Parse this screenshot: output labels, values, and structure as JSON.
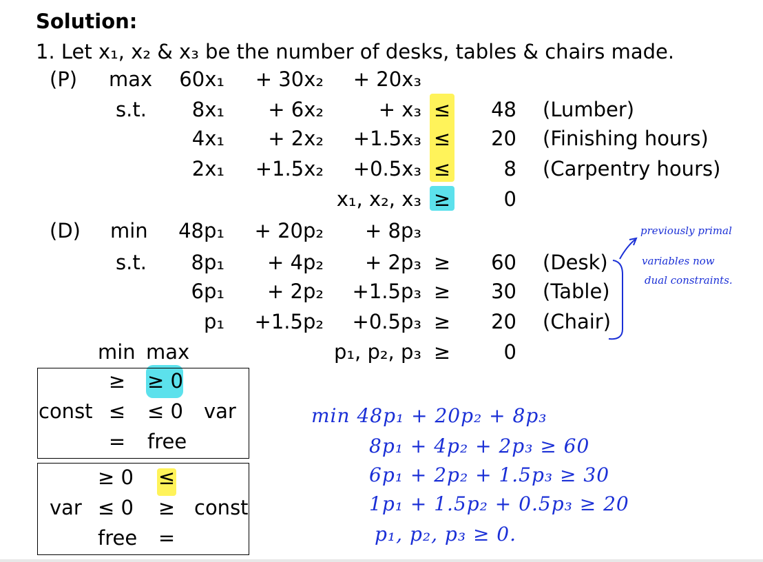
{
  "heading": "Solution:",
  "intro": "1. Let x₁, x₂ & x₃ be the number of desks, tables & chairs made.",
  "primal": {
    "label": "(P)",
    "obj_word": "max",
    "st_word": "s.t.",
    "obj": [
      "60x₁",
      "+ 30x₂",
      "+ 20x₃"
    ],
    "rows": [
      {
        "c1": "8x₁",
        "c2": "+  6x₂",
        "c3": "+      x₃",
        "rel": "≤",
        "rhs": "48",
        "name": "(Lumber)"
      },
      {
        "c1": "4x₁",
        "c2": "+  2x₂",
        "c3": "+1.5x₃",
        "rel": "≤",
        "rhs": "20",
        "name": "(Finishing hours)"
      },
      {
        "c1": "2x₁",
        "c2": "+1.5x₂",
        "c3": "+0.5x₃",
        "rel": "≤",
        "rhs": "8",
        "name": "(Carpentry hours)"
      }
    ],
    "sign": {
      "vars": "x₁, x₂, x₃",
      "rel": "≥",
      "rhs": "0"
    }
  },
  "dual": {
    "label": "(D)",
    "obj_word": "min",
    "st_word": "s.t.",
    "obj": [
      "48p₁",
      "+ 20p₂",
      "+  8p₃"
    ],
    "rows": [
      {
        "c1": "8p₁",
        "c2": "+  4p₂",
        "c3": "+  2p₃",
        "rel": "≥",
        "rhs": "60",
        "name": "(Desk)"
      },
      {
        "c1": "6p₁",
        "c2": "+  2p₂",
        "c3": "+1.5p₃",
        "rel": "≥",
        "rhs": "30",
        "name": "(Table)"
      },
      {
        "c1": "p₁",
        "c2": "+1.5p₂",
        "c3": "+0.5p₃",
        "rel": "≥",
        "rhs": "20",
        "name": "(Chair)"
      }
    ],
    "sign": {
      "vars": "p₁, p₂, p₃",
      "rel": "≥",
      "rhs": "0"
    }
  },
  "table_header": {
    "left": "min",
    "right": "max"
  },
  "box1": {
    "left_label": "const",
    "right_label": "var",
    "col1": [
      "≥",
      "≤",
      "="
    ],
    "col2": [
      "≥ 0",
      "≤ 0",
      "free"
    ]
  },
  "box2": {
    "left_label": "var",
    "right_label": "const",
    "col1": [
      "≥ 0",
      "≤ 0",
      "free"
    ],
    "col2": [
      "≤",
      "≥",
      "="
    ]
  },
  "handwriting": {
    "note": [
      "previously primal",
      "variables now",
      "dual constraints."
    ],
    "lines": [
      "min 48p₁ + 20p₂ + 8p₃",
      "8p₁ + 4p₂ + 2p₃ ≥ 60",
      "6p₁ + 2p₂ + 1.5p₃ ≥ 30",
      "1p₁ + 1.5p₂ + 0.5p₃ ≥ 20",
      "p₁, p₂, p₃ ≥ 0."
    ]
  },
  "colors": {
    "highlight_yellow": "#fff35a",
    "highlight_cyan": "#5ce1ec",
    "ink_blue": "#1a2fd6"
  }
}
